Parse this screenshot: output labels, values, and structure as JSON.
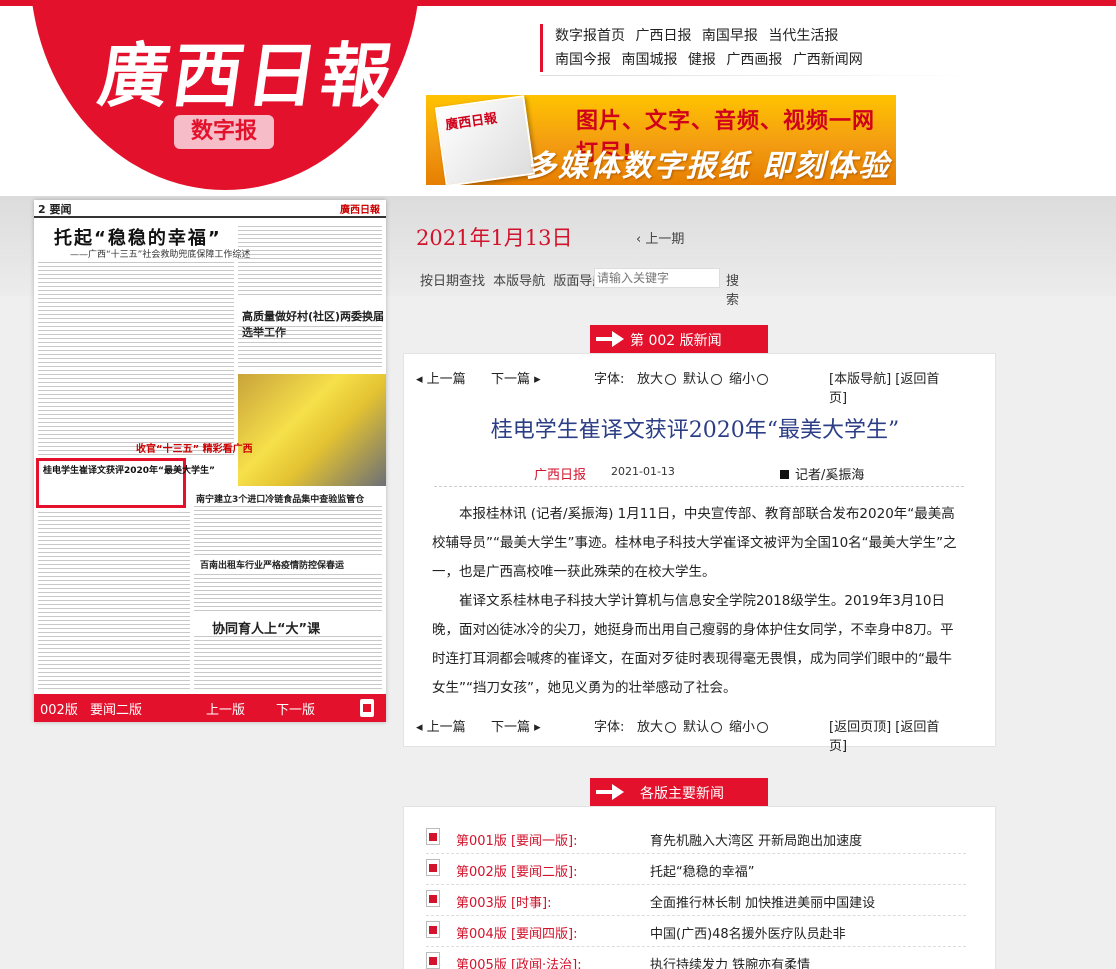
{
  "brand": {
    "logo_text": "廣西日報",
    "badge": "数字报"
  },
  "toplinks": {
    "row1": [
      "数字报首页",
      "广西日报",
      "南国早报",
      "当代生活报"
    ],
    "row2": [
      "南国今报",
      "南国城报",
      "健报",
      "广西画报",
      "广西新闻网"
    ]
  },
  "banner": {
    "line1": "图片、文字、音频、视频一网打尽!",
    "line2": "多媒体数字报纸  即刻体验"
  },
  "paper": {
    "page_label": "2 要闻",
    "masthead": "廣西日報",
    "headline": "托起“稳稳的幸福”",
    "subhead": "——广西“十三五”社会救助兜底保障工作综述",
    "h2a": "高质量做好村(社区)两委换届选举工作",
    "red_label": "收官“十三五” 精彩看广西",
    "highlight": "桂电学生崔译文获评2020年“最美大学生”",
    "h2b": "南宁建立3个进口冷链食品集中查验监管仓",
    "h2c": "百南出租车行业严格疫情防控保春运",
    "h2d": "协同育人上“大”课",
    "footer": {
      "page": "002版",
      "name": "要闻二版",
      "prev": "上一版",
      "next": "下一版"
    }
  },
  "issue": {
    "date": "2021年1月13日",
    "prev_issue": "‹  上一期"
  },
  "search": {
    "by_date": "按日期查找",
    "page_nav": "本版导航",
    "layout_nav": "版面导航",
    "placeholder": "请输入关键字",
    "button": "搜索"
  },
  "section_ribbon": "第 002 版新闻",
  "article": {
    "toolbar_top": {
      "prev": "上一篇",
      "next": "下一篇",
      "font": "字体:",
      "bigger": "放大",
      "default": "默认",
      "smaller": "缩小",
      "right": "[本版导航] [返回首页]"
    },
    "toolbar_bottom": {
      "right": "[返回页顶] [返回首页]"
    },
    "title": "桂电学生崔译文获评2020年“最美大学生”",
    "source": "广西日报",
    "date": "2021-01-13",
    "author": "记者/奚振海",
    "paragraphs": [
      "本报桂林讯 (记者/奚振海) 1月11日，中央宣传部、教育部联合发布2020年“最美高校辅导员”“最美大学生”事迹。桂林电子科技大学崔译文被评为全国10名“最美大学生”之一，也是广西高校唯一获此殊荣的在校大学生。",
      "崔译文系桂林电子科技大学计算机与信息安全学院2018级学生。2019年3月10日晚，面对凶徒冰冷的尖刀，她挺身而出用自己瘦弱的身体护住女同学，不幸身中8刀。平时连打耳洞都会喊疼的崔译文，在面对歹徒时表现得毫无畏惧，成为同学们眼中的“最牛女生”“挡刀女孩”，她见义勇为的壮举感动了社会。"
    ]
  },
  "main_news": {
    "ribbon": "各版主要新闻",
    "items": [
      {
        "ver": "第001版 [要闻一版]:",
        "title": "育先机融入大湾区 开新局跑出加速度"
      },
      {
        "ver": "第002版 [要闻二版]:",
        "title": "托起“稳稳的幸福”"
      },
      {
        "ver": "第003版 [时事]:",
        "title": "全面推行林长制 加快推进美丽中国建设"
      },
      {
        "ver": "第004版 [要闻四版]:",
        "title": "中国(广西)48名援外医疗队员赴非"
      },
      {
        "ver": "第005版 [政闻·法治]:",
        "title": "执行持续发力 铁腕亦有柔情"
      }
    ]
  },
  "colors": {
    "brand_red": "#e3112b",
    "title_blue": "#2c3f86"
  }
}
